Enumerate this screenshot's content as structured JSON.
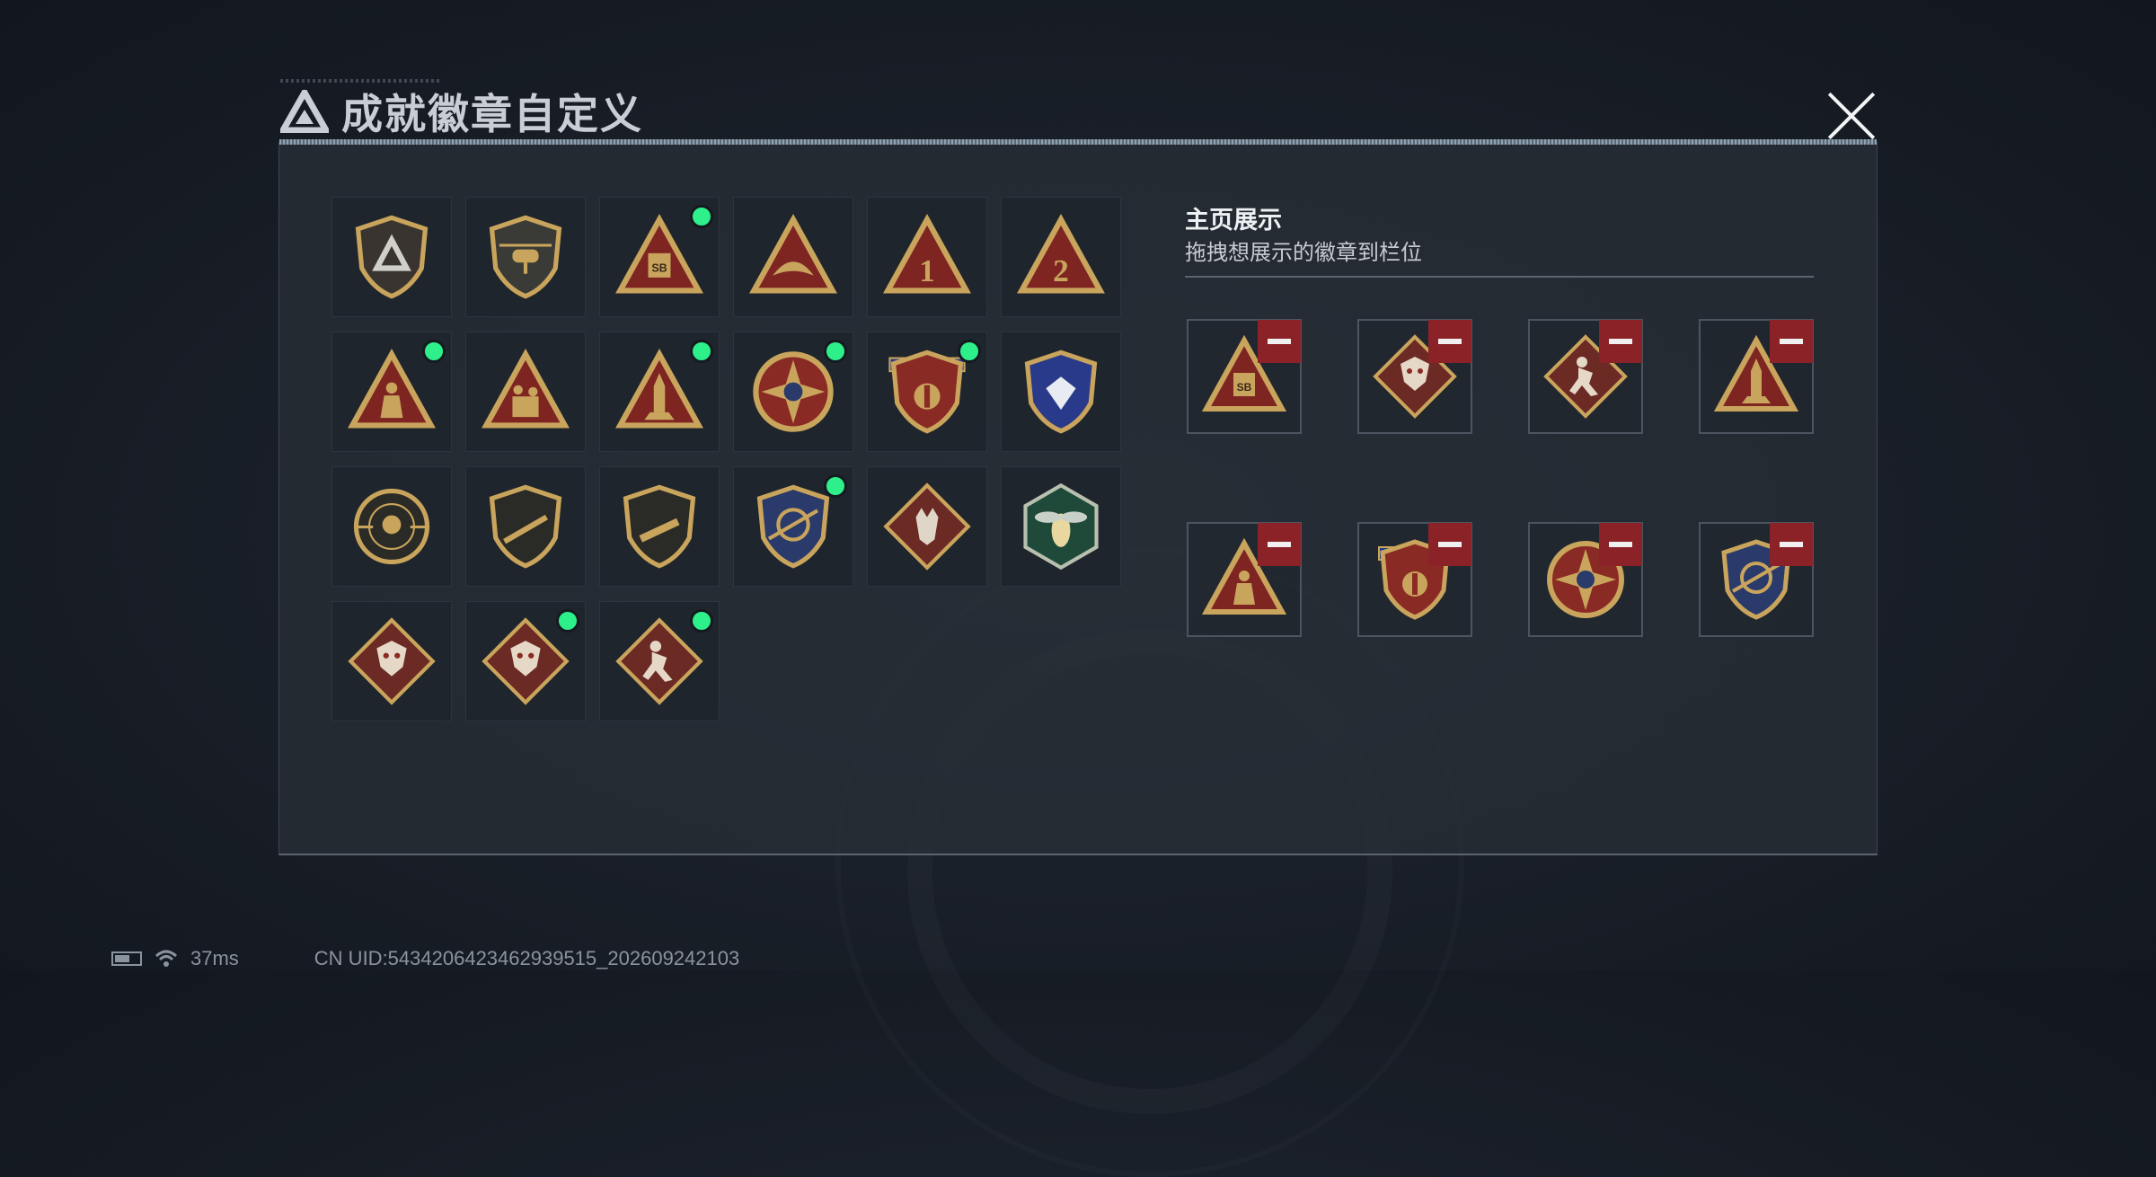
{
  "header": {
    "title": "成就徽章自定义",
    "close": "close"
  },
  "showcase": {
    "title": "主页展示",
    "subtitle": "拖拽想展示的徽章到栏位",
    "slots": [
      {
        "badge": "sb-triangle-badge"
      },
      {
        "badge": "dragon-diamond-badge"
      },
      {
        "badge": "runner-diamond-badge"
      },
      {
        "badge": "rocket-triangle-badge"
      },
      {
        "badge": "kneeling-soldier-triangle-badge"
      },
      {
        "badge": "banner-shield-badge"
      },
      {
        "badge": "compass-star-badge"
      },
      {
        "badge": "crossed-arrow-shield-badge"
      }
    ]
  },
  "badges": [
    {
      "icon": "shield-logo-badge",
      "new": false
    },
    {
      "icon": "helicopter-badge",
      "new": false
    },
    {
      "icon": "sb-triangle-badge",
      "new": true
    },
    {
      "icon": "wing-triangle-badge",
      "new": false
    },
    {
      "icon": "number-1-triangle-badge",
      "new": false
    },
    {
      "icon": "number-2-triangle-badge",
      "new": false
    },
    {
      "icon": "kneeling-soldier-triangle-badge",
      "new": true
    },
    {
      "icon": "soldiers-triangle-badge",
      "new": false
    },
    {
      "icon": "rocket-triangle-badge",
      "new": true
    },
    {
      "icon": "compass-star-badge",
      "new": true
    },
    {
      "icon": "banner-shield-badge",
      "new": true
    },
    {
      "icon": "diamond-gem-badge",
      "new": false
    },
    {
      "icon": "skull-crosshair-badge",
      "new": false
    },
    {
      "icon": "rifle-shield-badge",
      "new": false
    },
    {
      "icon": "smg-shield-badge",
      "new": false
    },
    {
      "icon": "crossed-arrow-shield-badge",
      "new": true
    },
    {
      "icon": "wolf-diamond-badge",
      "new": false
    },
    {
      "icon": "hornet-hexagon-badge",
      "new": false
    },
    {
      "icon": "dragon-diamond-badge",
      "new": false
    },
    {
      "icon": "dragon-diamond-badge",
      "new": true
    },
    {
      "icon": "runner-diamond-badge",
      "new": true
    }
  ],
  "status": {
    "ping": "37ms",
    "uid": "CN UID:5434206423462939515_202609242103"
  },
  "colors": {
    "gold": "#c9a45c",
    "red": "#7e2522",
    "accent_green": "#2ef08a",
    "remove_red": "#8a2228"
  }
}
